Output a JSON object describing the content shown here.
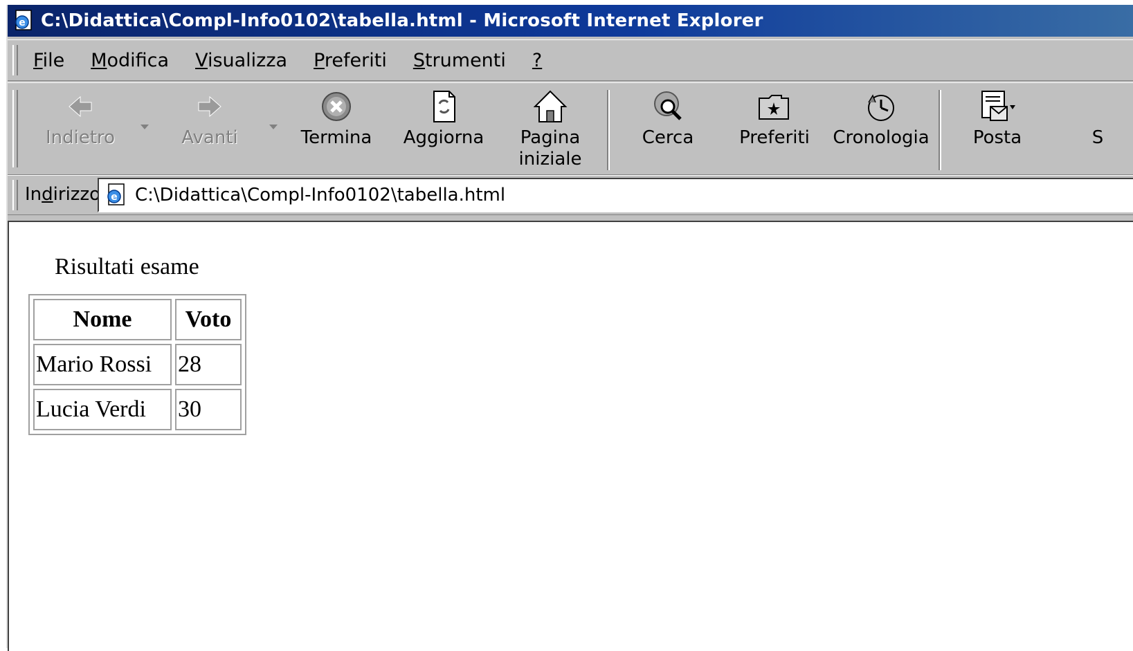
{
  "window": {
    "title": "C:\\Didattica\\Compl-Info0102\\tabella.html - Microsoft Internet Explorer"
  },
  "menu": {
    "items": [
      {
        "acc": "F",
        "rest": "ile"
      },
      {
        "acc": "M",
        "rest": "odifica"
      },
      {
        "acc": "V",
        "rest": "isualizza"
      },
      {
        "acc": "P",
        "rest": "referiti"
      },
      {
        "acc": "S",
        "rest": "trumenti"
      },
      {
        "acc": "?",
        "rest": ""
      }
    ]
  },
  "toolbar": {
    "back_label": "Indietro",
    "forward_label": "Avanti",
    "stop_label": "Termina",
    "refresh_label": "Aggiorna",
    "home_label": "Pagina\niniziale",
    "search_label": "Cerca",
    "favorites_label": "Preferiti",
    "history_label": "Cronologia",
    "mail_label": "Posta",
    "cut_label": "S"
  },
  "address": {
    "label_pre": "In",
    "label_acc": "d",
    "label_post": "irizzo",
    "value": "C:\\Didattica\\Compl-Info0102\\tabella.html"
  },
  "page": {
    "caption": "Risultati esame",
    "headers": [
      "Nome",
      "Voto"
    ],
    "rows": [
      {
        "nome": "Mario Rossi",
        "voto": "28"
      },
      {
        "nome": "Lucia Verdi",
        "voto": "30"
      }
    ]
  },
  "colors": {
    "titlebar_start": "#0a246a",
    "titlebar_end": "#3a6ea5",
    "chrome": "#c0c0c0"
  }
}
